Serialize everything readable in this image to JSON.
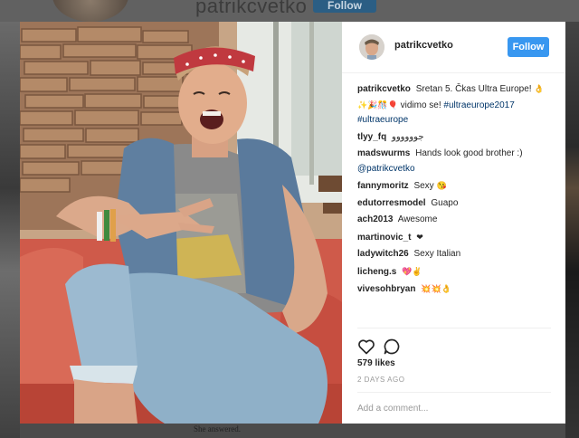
{
  "background": {
    "username": "patrikcvetko",
    "follow_label": "Follow",
    "caption_fragment": "She answered."
  },
  "post": {
    "username": "patrikcvetko",
    "follow_label": "Follow",
    "caption": {
      "username": "patrikcvetko",
      "text_1": "Sretan 5. Čkas Ultra Europe!",
      "emojis": "👌✨🎉🎊🎈",
      "text_2": "vidimo se!",
      "hashtag_1": "#ultraeurope2017",
      "hashtag_2": "#ultraeurope"
    },
    "comments": [
      {
        "user": "tlyy_fq",
        "text": "جوووووو"
      },
      {
        "user": "madswurms",
        "text": "Hands look good brother :)",
        "mention": "@patrikcvetko"
      },
      {
        "user": "fannymoritz",
        "text": "Sexy",
        "emoji": "😘"
      },
      {
        "user": "edutorresmodel",
        "text": "Guapo"
      },
      {
        "user": "ach2013",
        "text": "Awesome"
      },
      {
        "user": "martinovic_t",
        "text": "",
        "emoji": "❤"
      },
      {
        "user": "ladywitch26",
        "text": "Sexy Italian"
      },
      {
        "user": "licheng.s",
        "text": "",
        "emoji": "💖✌"
      },
      {
        "user": "vivesohbryan",
        "text": "",
        "emoji": "💥💥👌"
      }
    ],
    "likes": "579 likes",
    "timestamp": "2 DAYS AGO",
    "comment_placeholder": "Add a comment...",
    "icons": [
      "heart-icon",
      "comment-icon"
    ],
    "colors": {
      "follow": "#3897f0",
      "link": "#003569",
      "muted": "#999999"
    }
  }
}
